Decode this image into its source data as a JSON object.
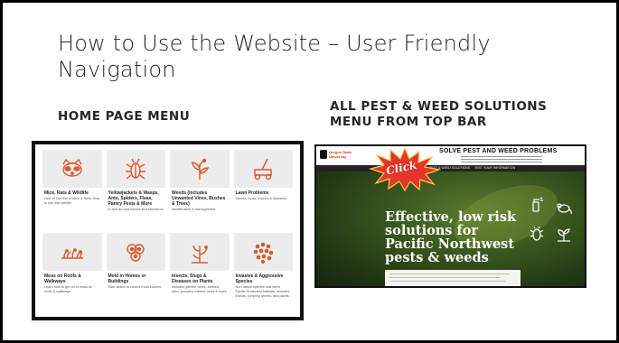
{
  "slide": {
    "title": "How to Use the Website – User Friendly Navigation",
    "left_heading": "Home page menu",
    "right_heading": "All Pest & Weed Solutions Menu from Top Bar"
  },
  "home_menu": {
    "cards": [
      {
        "title": "Mice, Rats & Wildlife",
        "desc": "How to Get Rid of Mice & Rats: How to live with wildlife",
        "icon": "raccoon-icon"
      },
      {
        "title": "Yellowjackets & Wasps, Ants, Spiders, Fleas, Pantry Pests & More",
        "desc": "In and around homes and structures",
        "icon": "beetle-icon"
      },
      {
        "title": "Weeds (includes Unwanted Vines, Bushes & Trees)",
        "desc": "Identification & management",
        "icon": "weed-icon"
      },
      {
        "title": "Lawn Problems",
        "desc": "Weeds, moss, insects & diseases",
        "icon": "lawnmower-icon"
      },
      {
        "title": "Moss on Roofs & Walkways",
        "desc": "Learn how to get rid of moss on roofs & walkways",
        "icon": "moss-icon"
      },
      {
        "title": "Mold in Homes or Buildings",
        "desc": "Take action to control mold indoors",
        "icon": "mold-icon"
      },
      {
        "title": "Insects, Slugs & Diseases on Plants",
        "desc": "Includes garden, trees, edibles, lawn, powdery mildew, mold & more",
        "icon": "plant-disease-icon"
      },
      {
        "title": "Invasive & Aggressive Species",
        "desc": "Non-native species that harm Pacific Northwest habitats, includes insects, jumping worms, and plants",
        "icon": "invasive-icon"
      }
    ]
  },
  "pest_site": {
    "logo_text": "Oregon State University",
    "site_title": "SOLVE PEST AND WEED PROBLEMS",
    "nav_items": [
      "ALL PEST & WEED SOLUTIONS",
      "TEST YOUR INFORMATION"
    ],
    "hero_text": "Effective, low risk solutions for Pacific Northwest pests & weeds",
    "callout": "Click",
    "accent_color": "#d73f09"
  }
}
